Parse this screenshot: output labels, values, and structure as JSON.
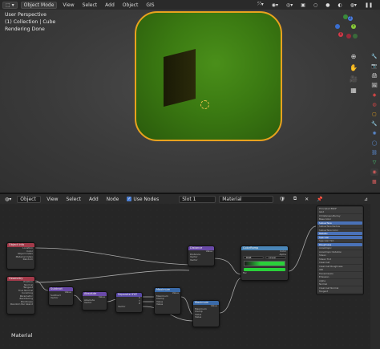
{
  "viewport": {
    "mode": "Object Mode",
    "menu": [
      "View",
      "Select",
      "Add",
      "Object",
      "GIS"
    ],
    "perspective": "User Perspective",
    "collection": "(1) Collection | Cube",
    "status": "Rendering Done",
    "gizmo": [
      "Y",
      "Z",
      "X"
    ]
  },
  "node_editor": {
    "editor_type": "Object",
    "menu": [
      "View",
      "Select",
      "Add",
      "Node"
    ],
    "use_nodes_label": "Use Nodes",
    "slot": "Slot 1",
    "material": "Material",
    "material_label": "Material",
    "nodes": {
      "texcoord": {
        "title": "Object Info",
        "rows": [
          "Location",
          "Color",
          "Object Index",
          "Material Index",
          "Random"
        ]
      },
      "geometry": {
        "title": "Geometry",
        "rows": [
          "Position",
          "Normal",
          "Tangent",
          "True Normal",
          "Incoming",
          "Parametric",
          "Backfacing",
          "Pointiness",
          "Random Per Island"
        ]
      },
      "separate": {
        "title": "Subtract",
        "rows": [
          "Value",
          "Subtract",
          "Vector"
        ]
      },
      "math1": {
        "title": "Absolute",
        "rows": [
          "Value",
          "Absolute",
          "Vector"
        ]
      },
      "math2": {
        "title": "Separate XYZ",
        "rows": [
          "X",
          "Y",
          "Z",
          "Vector"
        ]
      },
      "math3": {
        "title": "Maximum",
        "rows": [
          "Value",
          "Maximum",
          "Clamp",
          "Value",
          "Value"
        ]
      },
      "math4": {
        "title": "Maximum",
        "rows": [
          "Value",
          "Maximum",
          "Clamp",
          "Value",
          "Value"
        ]
      },
      "mathtop": {
        "title": "Distance",
        "rows": [
          "Value",
          "Distance",
          "Vector",
          "Vector"
        ]
      },
      "ramp": {
        "title": "ColorRamp",
        "rows": [
          "Color",
          "Alpha",
          "RGB",
          "Linear",
          "Fac"
        ]
      }
    },
    "bsdf_rows": [
      "Principled BSDF",
      "GGX",
      "Christensen-Burley",
      "Base Color",
      "Subsurface",
      "Subsurface Radius",
      "Subsurface Color",
      "Metallic",
      "Specular",
      "Specular Tint",
      "Roughness",
      "Anisotropic",
      "Anisotropic Rotation",
      "Sheen",
      "Sheen Tint",
      "Clearcoat",
      "Clearcoat Roughness",
      "IOR",
      "Transmission",
      "Emission",
      "Alpha",
      "Normal",
      "Clearcoat Normal",
      "Tangent"
    ]
  }
}
